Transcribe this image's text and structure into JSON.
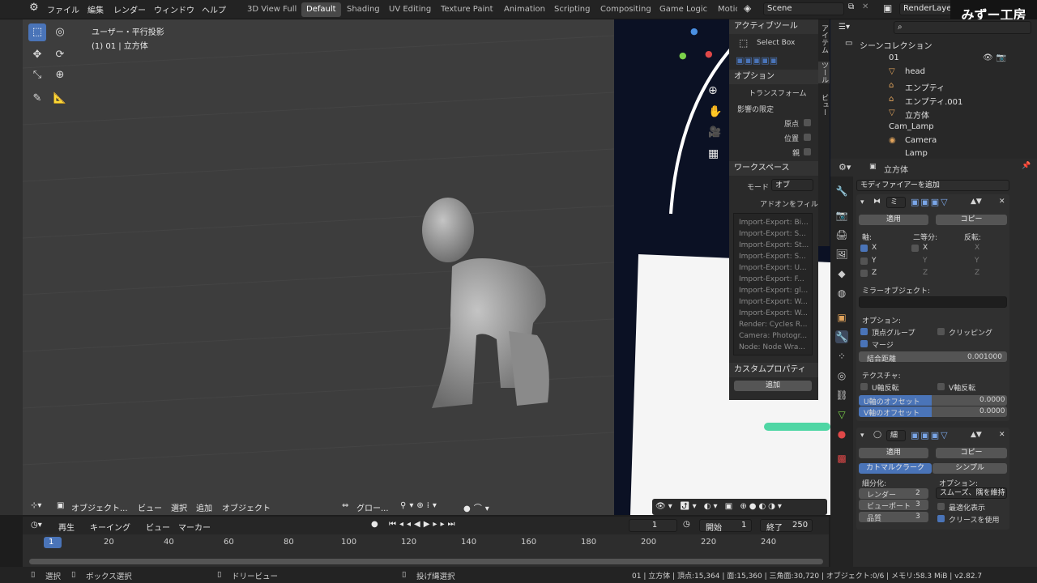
{
  "menu": [
    "ファイル",
    "編集",
    "レンダー",
    "ウィンドウ",
    "ヘルプ"
  ],
  "workspaces": [
    "3D View Full",
    "Default",
    "Shading",
    "UV Editing",
    "Texture Paint",
    "Animation",
    "Scripting",
    "Compositing",
    "Game Logic",
    "Motio"
  ],
  "active_workspace": "Default",
  "scene_name": "Scene",
  "render_layer": "RenderLayer",
  "watermark": "みずー工房",
  "viewport": {
    "view_name": "ユーザー・平行投影",
    "object_info": "(1) 01 | 立方体"
  },
  "viewport_header": {
    "mode": "オブジェクト...",
    "view": "ビュー",
    "select": "選択",
    "add": "追加",
    "object": "オブジェクト",
    "orientation": "グロー..."
  },
  "npanel": {
    "active_tool": "アクティブツール",
    "select_box": "Select Box",
    "options": "オプション",
    "transform": "トランスフォーム",
    "limit": "影響の限定",
    "origin": "原点",
    "location": "位置",
    "parent": "親",
    "workspace": "ワークスペース",
    "mode_label": "モード",
    "mode_value": "オブ",
    "addon_filter": "アドオンをフィル",
    "addons": [
      "Import-Export: Bi...",
      "Import-Export: S...",
      "Import-Export: St...",
      "Import-Export: S...",
      "Import-Export: U...",
      "Import-Export: F...",
      "Import-Export: gl...",
      "Import-Export: W...",
      "Import-Export: W...",
      "Render: Cycles R...",
      "Camera: Photogr...",
      "Node: Node Wra..."
    ],
    "custom_props": "カスタムプロパティ",
    "add": "追加"
  },
  "vertical_tabs": [
    "アイテム",
    "ツール",
    "ビュー"
  ],
  "outliner": {
    "title": "シーンコレクション",
    "items": [
      {
        "label": "01"
      },
      {
        "label": "head"
      },
      {
        "label": "エンプティ"
      },
      {
        "label": "エンプティ.001"
      },
      {
        "label": "立方体"
      },
      {
        "label": "Cam_Lamp"
      },
      {
        "label": "Camera"
      },
      {
        "label": "Lamp"
      }
    ]
  },
  "properties": {
    "object_name": "立方体",
    "add_modifier": "モディファイアーを追加",
    "mirror": {
      "name": "ミ",
      "apply": "適用",
      "copy": "コピー",
      "axis": "軸:",
      "bisect": "二等分:",
      "flip": "反転:",
      "x": "X",
      "y": "Y",
      "z": "Z",
      "mirror_object": "ミラーオブジェクト:",
      "options": "オプション:",
      "vertex_groups": "頂点グループ",
      "clipping": "クリッピング",
      "merge": "マージ",
      "merge_distance_label": "結合距離",
      "merge_distance": "0.001000",
      "texture": "テクスチャ:",
      "u_flip": "U軸反転",
      "v_flip": "V軸反転",
      "u_offset_label": "U軸のオフセット",
      "u_offset": "0.0000",
      "v_offset_label": "V軸のオフセット",
      "v_offset": "0.0000"
    },
    "subsurf": {
      "name": "細",
      "apply": "適用",
      "copy": "コピー",
      "catmull": "カトマルクラーク",
      "simple": "シンプル",
      "subdiv": "細分化:",
      "options": "オプション:",
      "render_label": "レンダー",
      "render": "2",
      "viewport_label": "ビューポート",
      "viewport": "3",
      "quality_label": "品質",
      "quality": "3",
      "smooth": "スムーズ、隅を維持",
      "optimal": "最適化表示",
      "use_crease": "クリースを使用"
    }
  },
  "timeline": {
    "play": "再生",
    "keying": "キーイング",
    "view": "ビュー",
    "marker": "マーカー",
    "current": "1",
    "start_label": "開始",
    "start": "1",
    "end_label": "終了",
    "end": "250",
    "ticks": [
      "1",
      "20",
      "40",
      "60",
      "80",
      "100",
      "120",
      "140",
      "160",
      "180",
      "200",
      "220",
      "240"
    ]
  },
  "status": {
    "select": "選択",
    "box_select": "ボックス選択",
    "drag_view": "ドリービュー",
    "lasso": "投げ縄選択",
    "info": "01 | 立方体 | 頂点:15,364 | 面:15,360 | 三角面:30,720 | オブジェクト:0/6 | メモリ:58.3 MiB | v2.82.7"
  }
}
